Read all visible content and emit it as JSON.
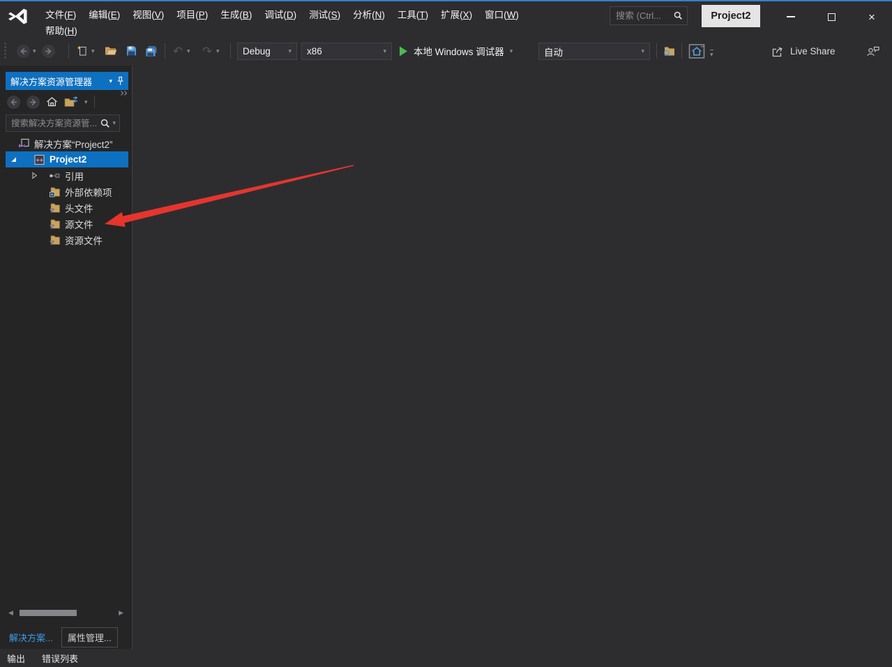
{
  "titlebar": {
    "menus": [
      "文件(F)",
      "编辑(E)",
      "视图(V)",
      "项目(P)",
      "生成(B)",
      "调试(D)",
      "测试(S)",
      "分析(N)",
      "工具(T)",
      "扩展(X)",
      "窗口(W)"
    ],
    "menu_help": "帮助(H)",
    "search_placeholder": "搜索 (Ctrl...",
    "project_badge": "Project2"
  },
  "toolbar": {
    "config_value": "Debug",
    "platform_value": "x86",
    "debugger_label": "本地 Windows 调试器",
    "auto_value": "自动",
    "live_share_label": "Live Share"
  },
  "solution_explorer": {
    "title": "解决方案资源管理器",
    "search_placeholder": "搜索解决方案资源管...",
    "tree": [
      {
        "label": "解决方案“Project2”"
      },
      {
        "label": "Project2"
      },
      {
        "label": "引用"
      },
      {
        "label": "外部依赖项"
      },
      {
        "label": "头文件"
      },
      {
        "label": "源文件"
      },
      {
        "label": "资源文件"
      }
    ],
    "tabs": [
      {
        "label": "解决方案..."
      },
      {
        "label": "属性管理..."
      }
    ]
  },
  "statusbar": {
    "items": [
      {
        "label": "输出"
      },
      {
        "label": "错误列表"
      }
    ]
  },
  "colors": {
    "accent": "#0E70C0",
    "arrow_red": "#E5352D",
    "folder_tan": "#C8A35E",
    "play_green": "#4CBB51",
    "save_blue": "#5598D8",
    "active_tab_blue": "#3E9BE9"
  }
}
